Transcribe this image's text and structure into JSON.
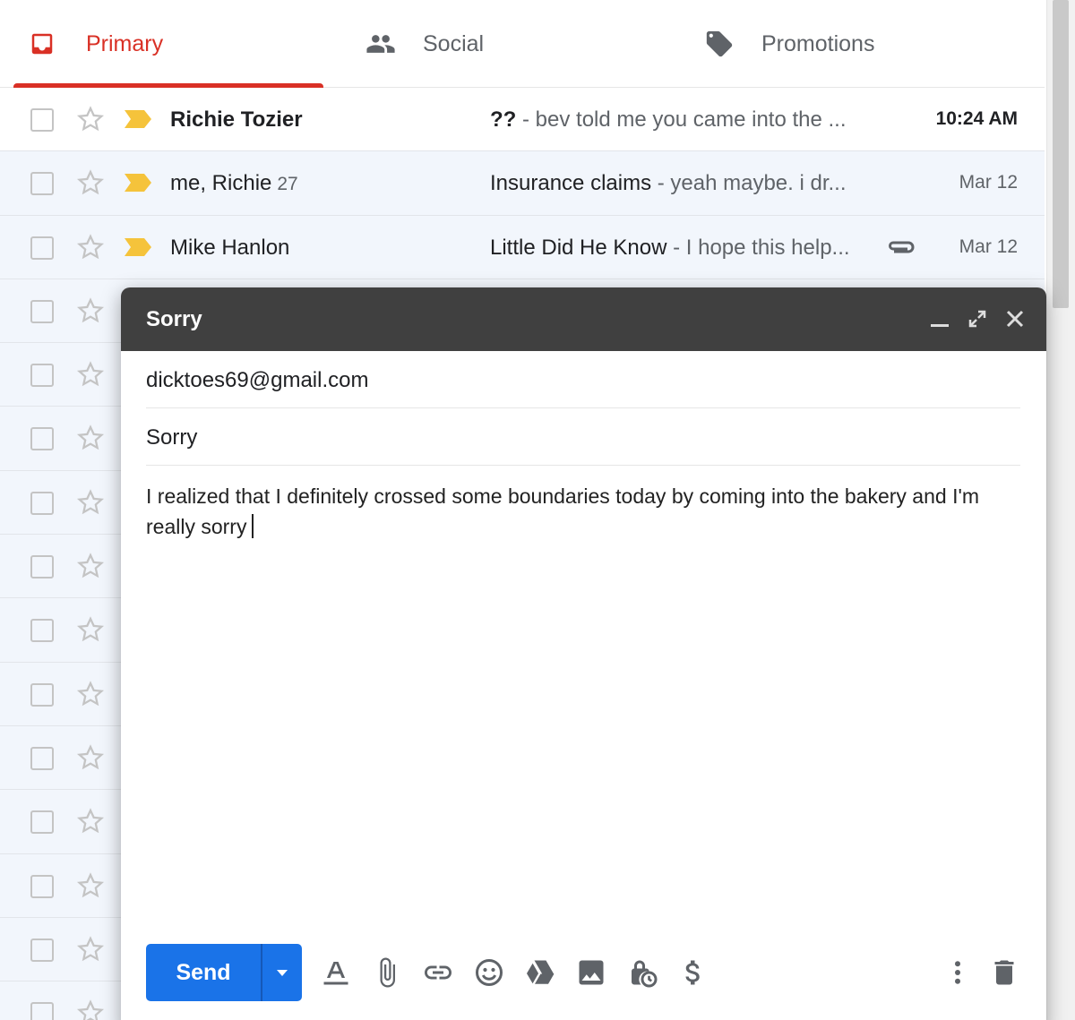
{
  "tabs": [
    {
      "label": "Primary",
      "icon": "inbox-icon",
      "active": true
    },
    {
      "label": "Social",
      "icon": "people-icon",
      "active": false
    },
    {
      "label": "Promotions",
      "icon": "tag-icon",
      "active": false
    }
  ],
  "colors": {
    "accent": "#d93025",
    "send": "#1a73e8",
    "compose_header": "#404040",
    "important_marker": "#f5c33b"
  },
  "emails": [
    {
      "sender": "Richie Tozier",
      "count": "",
      "subject": "??",
      "snippet": " - bev told me you came into the ...",
      "date": "10:24 AM",
      "unread": true,
      "attachment": false
    },
    {
      "sender": "me, Richie",
      "count": "27",
      "subject": "Insurance claims",
      "snippet": " - yeah maybe. i dr...",
      "date": "Mar 12",
      "unread": false,
      "attachment": false
    },
    {
      "sender": "Mike Hanlon",
      "count": "",
      "subject": "Little Did He Know",
      "snippet": " - I hope this help...",
      "date": "Mar 12",
      "unread": false,
      "attachment": true
    }
  ],
  "compose": {
    "title": "Sorry",
    "to": "dicktoes69@gmail.com",
    "subject": "Sorry",
    "body": "I realized that I definitely crossed some boundaries today by coming into the bakery and I'm really sorry",
    "send_label": "Send",
    "toolbar_icons": [
      "format-text-icon",
      "attach-icon",
      "link-icon",
      "emoji-icon",
      "drive-icon",
      "photo-icon",
      "confidential-mode-icon",
      "money-icon",
      "more-options-icon",
      "discard-icon"
    ]
  }
}
